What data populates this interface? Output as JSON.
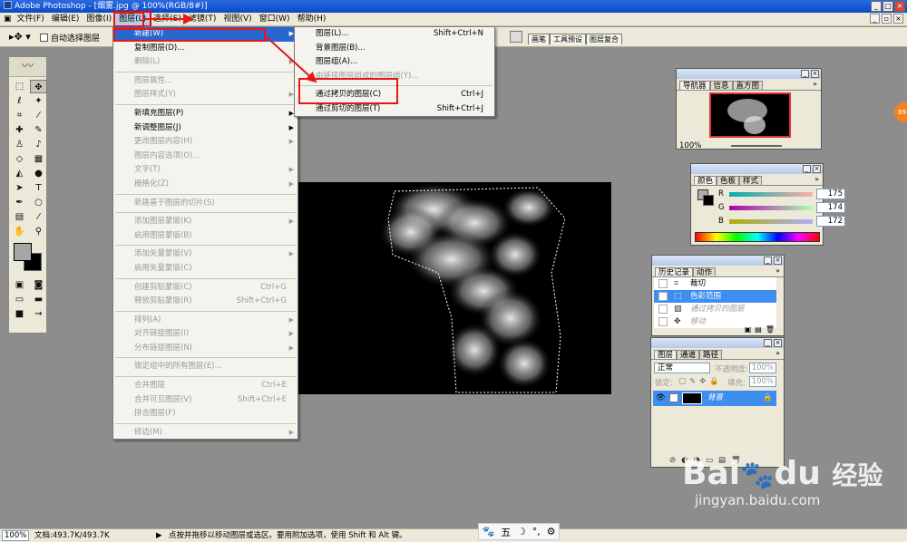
{
  "window": {
    "title": "Adobe Photoshop - [烟雾.jpg @ 100%(RGB/8#)]"
  },
  "menubar": [
    "文件(F)",
    "编辑(E)",
    "图像(I)",
    "图层(L)",
    "选择(S)",
    "滤镜(T)",
    "视图(V)",
    "窗口(W)",
    "帮助(H)"
  ],
  "options": {
    "auto_select_label": "自动选择图层",
    "palette_tabs": [
      "画笔",
      "工具预设",
      "图层复合"
    ]
  },
  "layer_menu": [
    {
      "label": "新建(W)",
      "sub": true,
      "hl": true
    },
    {
      "label": "复制图层(D)..."
    },
    {
      "label": "删除(L)",
      "sub": true,
      "dis": true
    },
    {
      "sep": true
    },
    {
      "label": "图层属性...",
      "dis": true
    },
    {
      "label": "图层样式(Y)",
      "sub": true,
      "dis": true
    },
    {
      "sep": true
    },
    {
      "label": "新填充图层(P)",
      "sub": true
    },
    {
      "label": "新调整图层(J)",
      "sub": true
    },
    {
      "label": "更改图层内容(H)",
      "sub": true,
      "dis": true
    },
    {
      "label": "图层内容选项(O)...",
      "dis": true
    },
    {
      "label": "文字(T)",
      "sub": true,
      "dis": true
    },
    {
      "label": "栅格化(Z)",
      "sub": true,
      "dis": true
    },
    {
      "sep": true
    },
    {
      "label": "新建基于图层的切片(S)",
      "dis": true
    },
    {
      "sep": true
    },
    {
      "label": "添加图层蒙版(K)",
      "sub": true,
      "dis": true
    },
    {
      "label": "启用图层蒙版(B)",
      "dis": true
    },
    {
      "sep": true
    },
    {
      "label": "添加矢量蒙版(V)",
      "sub": true,
      "dis": true
    },
    {
      "label": "启用矢量蒙版(C)",
      "dis": true
    },
    {
      "sep": true
    },
    {
      "label": "创建剪贴蒙版(C)",
      "shortcut": "Ctrl+G",
      "dis": true
    },
    {
      "label": "释放剪贴蒙版(R)",
      "shortcut": "Shift+Ctrl+G",
      "dis": true
    },
    {
      "sep": true
    },
    {
      "label": "排列(A)",
      "sub": true,
      "dis": true
    },
    {
      "label": "对齐链接图层(I)",
      "sub": true,
      "dis": true
    },
    {
      "label": "分布链接图层(N)",
      "sub": true,
      "dis": true
    },
    {
      "sep": true
    },
    {
      "label": "锁定组中的所有图层(E)...",
      "dis": true
    },
    {
      "sep": true
    },
    {
      "label": "合并图层",
      "shortcut": "Ctrl+E",
      "dis": true
    },
    {
      "label": "合并可见图层(V)",
      "shortcut": "Shift+Ctrl+E",
      "dis": true
    },
    {
      "label": "拼合图层(F)",
      "dis": true
    },
    {
      "sep": true
    },
    {
      "label": "修边(M)",
      "sub": true,
      "dis": true
    }
  ],
  "new_submenu": [
    {
      "label": "图层(L)...",
      "shortcut": "Shift+Ctrl+N"
    },
    {
      "label": "背景图层(B)..."
    },
    {
      "label": "图层组(A)..."
    },
    {
      "label": "由链接图层组成的图层组(Y)...",
      "dis": true
    },
    {
      "sep": true
    },
    {
      "label": "通过拷贝的图层(C)",
      "shortcut": "Ctrl+J"
    },
    {
      "label": "通过剪切的图层(T)",
      "shortcut": "Shift+Ctrl+J"
    }
  ],
  "navigator": {
    "tabs": [
      "导航器",
      "信息",
      "直方图"
    ],
    "zoom": "100%"
  },
  "color": {
    "tabs": [
      "颜色",
      "色板",
      "样式"
    ],
    "channels": [
      {
        "label": "R",
        "value": "175"
      },
      {
        "label": "G",
        "value": "174"
      },
      {
        "label": "B",
        "value": "172"
      }
    ]
  },
  "history": {
    "tabs": [
      "历史记录",
      "动作"
    ],
    "items": [
      {
        "label": "裁切"
      },
      {
        "label": "色彩范围",
        "sel": true
      },
      {
        "label": "通过拷贝的图层",
        "dim": true
      },
      {
        "label": "移动",
        "dim": true
      }
    ]
  },
  "layers": {
    "tabs": [
      "图层",
      "通道",
      "路径"
    ],
    "blend_mode": "正常",
    "opacity_label": "不透明度:",
    "opacity": "100%",
    "lock_label": "锁定:",
    "fill_label": "填充:",
    "fill": "100%",
    "layer_name": "背景"
  },
  "status": {
    "zoom": "100%",
    "doc": "文档:493.7K/493.7K",
    "hint": "点按并拖移以移动图层或选区。要用附加选项，使用 Shift 和 Alt 键。"
  },
  "ime": [
    "五",
    "°,",
    "⚙"
  ],
  "watermark": {
    "brand": "Bai",
    "brand2": "du",
    "cn": "经验",
    "url": "jingyan.baidu.com"
  },
  "badge": "89"
}
